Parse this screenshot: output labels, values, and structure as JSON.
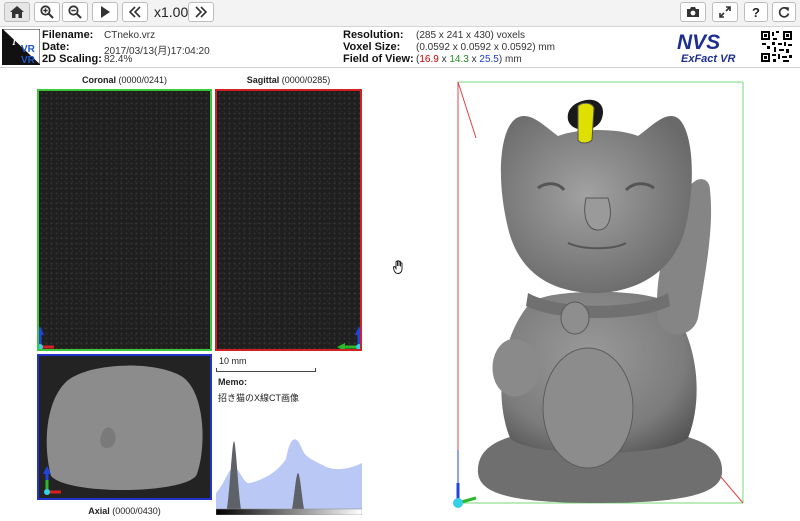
{
  "toolbar": {
    "buttons": [
      {
        "name": "home-button",
        "icon": "home-icon"
      },
      {
        "name": "zoom-in-button",
        "icon": "zoom-in-icon"
      },
      {
        "name": "zoom-out-button",
        "icon": "zoom-out-icon"
      },
      {
        "name": "play-button",
        "icon": "play-icon"
      },
      {
        "name": "rewind-button",
        "icon": "chevrons-left-icon"
      },
      {
        "name": "forward-button",
        "icon": "chevrons-right-icon"
      },
      {
        "name": "camera-button",
        "icon": "camera-icon"
      },
      {
        "name": "fullscreen-button",
        "icon": "expand-icon"
      },
      {
        "name": "help-button",
        "icon": "help-icon"
      },
      {
        "name": "reload-button",
        "icon": "reload-icon"
      }
    ],
    "zoom": "x1.00",
    "help_label": "?"
  },
  "info": {
    "filename_label": "Filename:",
    "filename": "CTneko.vrz",
    "date_label": "Date:",
    "date": "2017/03/13(月)17:04:20",
    "scaling_label": "2D Scaling:",
    "scaling": "82.4%",
    "resolution_label": "Resolution:",
    "resolution": "(285 x 241 x 430) voxels",
    "voxel_label": "Voxel Size:",
    "voxel": "(0.0592 x 0.0592 x 0.0592) mm",
    "fov_label": "Field of View:",
    "fov_open": "(",
    "fov_x": "16.9",
    "fov_sep1": " x ",
    "fov_y": "14.3",
    "fov_sep2": " x ",
    "fov_z": "25.5",
    "fov_close": ") mm",
    "brand_top": "NVS",
    "brand_bottom": "ExFact VR",
    "app_logo_text": "VR"
  },
  "views": {
    "coronal_name": "Coronal",
    "coronal_idx": "(0000/0241)",
    "sagittal_name": "Sagittal",
    "sagittal_idx": "(0000/0285)",
    "axial_name": "Axial",
    "axial_idx": "(0000/0430)"
  },
  "scale": "10 mm",
  "memo": {
    "label": "Memo:",
    "text": "招き猫のX線CT画像"
  },
  "colors": {
    "coronal_border": "#38c838",
    "sagittal_border": "#d42020",
    "axial_border": "#2233cc",
    "histogram_fill": "#b9c8f5"
  }
}
